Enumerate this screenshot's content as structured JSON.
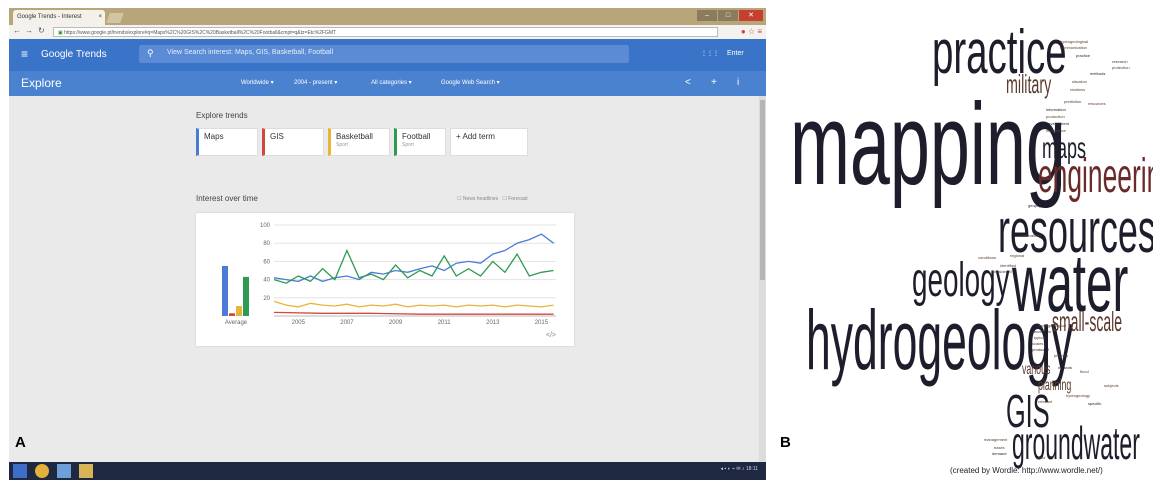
{
  "browser": {
    "tab_title": "Google Trends - Interest",
    "url": "https://www.google.pt/trends/explore#q=Maps%2C%20GIS%2C%20Basketball%2C%20Football&cmpt=q&tz=Etc%2FGMT",
    "url_secure": "https",
    "nav": {
      "back": "←",
      "forward": "→",
      "reload": "↻"
    },
    "window_controls": {
      "minimize": "–",
      "maximize": "□",
      "close": "✕"
    }
  },
  "google_trends": {
    "logo": "Google Trends",
    "search_text": "View Search interest: Maps, GIS, Basketball, Football",
    "header_right": {
      "apps": "⋮⋮⋮",
      "enter": "Enter"
    },
    "page_title": "Explore",
    "filters": [
      "Worldwide ▾",
      "2004 - present ▾",
      "All categories ▾",
      "Google Web Search ▾"
    ],
    "actions": {
      "share": "<",
      "add": "+",
      "info": "i"
    },
    "explore_trends_label": "Explore trends",
    "terms": [
      {
        "label": "Maps",
        "sub": "",
        "color": "#4a7bd6"
      },
      {
        "label": "GIS",
        "sub": "",
        "color": "#d04a3c"
      },
      {
        "label": "Basketball",
        "sub": "Sport",
        "color": "#e9b43a"
      },
      {
        "label": "Football",
        "sub": "Sport",
        "color": "#2e9a52"
      }
    ],
    "add_term": "+ Add term",
    "interest_label": "Interest over time",
    "news_headlines": "☐ News headlines",
    "forecast": "☐ Forecast",
    "embed": "</>"
  },
  "chart_data": {
    "type": "line",
    "title": "",
    "xlabel": "",
    "ylabel": "",
    "yticks": [
      20,
      40,
      60,
      80,
      100
    ],
    "xticks": [
      "2005",
      "2007",
      "2009",
      "2011",
      "2013",
      "2015"
    ],
    "xlim": [
      2004,
      2015.6
    ],
    "ylim": [
      0,
      100
    ],
    "average": {
      "label": "Average",
      "values": [
        {
          "name": "Maps",
          "value": 55
        },
        {
          "name": "GIS",
          "value": 3
        },
        {
          "name": "Basketball",
          "value": 11
        },
        {
          "name": "Football",
          "value": 43
        }
      ]
    },
    "series": [
      {
        "name": "Maps",
        "color": "#4a7bd6",
        "x": [
          2004.0,
          2004.5,
          2005.0,
          2005.5,
          2006.0,
          2006.5,
          2007.0,
          2007.5,
          2008.0,
          2008.5,
          2009.0,
          2009.5,
          2010.0,
          2010.5,
          2011.0,
          2011.5,
          2012.0,
          2012.5,
          2013.0,
          2013.5,
          2014.0,
          2014.5,
          2015.0,
          2015.5
        ],
        "y": [
          42,
          40,
          38,
          44,
          38,
          42,
          44,
          40,
          48,
          46,
          50,
          48,
          52,
          55,
          50,
          58,
          60,
          58,
          68,
          72,
          80,
          84,
          90,
          80
        ]
      },
      {
        "name": "GIS",
        "color": "#d04a3c",
        "x": [
          2004.0,
          2006.0,
          2008.0,
          2010.0,
          2012.0,
          2014.0,
          2015.5
        ],
        "y": [
          4,
          3,
          3,
          2,
          2,
          2,
          2
        ]
      },
      {
        "name": "Basketball",
        "color": "#e9b43a",
        "x": [
          2004.0,
          2004.5,
          2005.0,
          2005.5,
          2006.0,
          2006.5,
          2007.0,
          2007.5,
          2008.0,
          2008.5,
          2009.0,
          2009.5,
          2010.0,
          2010.5,
          2011.0,
          2011.5,
          2012.0,
          2012.5,
          2013.0,
          2013.5,
          2014.0,
          2014.5,
          2015.0,
          2015.5
        ],
        "y": [
          16,
          12,
          10,
          14,
          12,
          11,
          13,
          10,
          12,
          11,
          13,
          10,
          12,
          11,
          12,
          10,
          12,
          11,
          12,
          10,
          12,
          11,
          10,
          12
        ]
      },
      {
        "name": "Football",
        "color": "#2e9a52",
        "x": [
          2004.0,
          2004.5,
          2005.0,
          2005.5,
          2006.0,
          2006.5,
          2007.0,
          2007.5,
          2008.0,
          2008.5,
          2009.0,
          2009.5,
          2010.0,
          2010.5,
          2011.0,
          2011.5,
          2012.0,
          2012.5,
          2013.0,
          2013.5,
          2014.0,
          2014.5,
          2015.0,
          2015.5
        ],
        "y": [
          40,
          36,
          44,
          38,
          52,
          40,
          72,
          42,
          46,
          40,
          56,
          42,
          50,
          44,
          66,
          44,
          52,
          44,
          60,
          48,
          68,
          44,
          48,
          50
        ]
      }
    ]
  },
  "taskbar": {
    "tray": "◂ ▪ ◐ ⌁ ✉ ♪  18:11"
  },
  "labels": {
    "a": "A",
    "b": "B"
  },
  "wordcloud": {
    "colors": {
      "dark": "#1d1d2b",
      "brown": "#5a3a2e",
      "maroon": "#6b2a2a"
    },
    "words": {
      "mapping": "mapping",
      "practice": "practice",
      "military": "military",
      "maps": "maps",
      "engineering": "engineering",
      "resources": "resources",
      "geology": "geology",
      "water": "water",
      "hydrogeology": "hydrogeology",
      "small_scale": "small-scale",
      "various": "various",
      "planning": "planning",
      "gis": "GIS",
      "groundwater": "groundwater",
      "tiny": [
        "hydrogeological",
        "communication",
        "practice",
        "situation",
        "relations",
        "prediction",
        "information",
        "production",
        "development",
        "importance",
        "geophysics",
        "vulnerability",
        "conditions",
        "hydrogeological",
        "economic",
        "typical",
        "scales",
        "produced",
        "projects",
        "network",
        "identified",
        "considered",
        "regional",
        "flood",
        "management",
        "hydrogeology",
        "specific",
        "relevant",
        "field",
        "bases",
        "demand",
        "subjects",
        "research",
        "protection",
        "methods",
        "resources"
      ]
    },
    "caption": "(created by Wordle: http://www.wordle.net/)"
  }
}
